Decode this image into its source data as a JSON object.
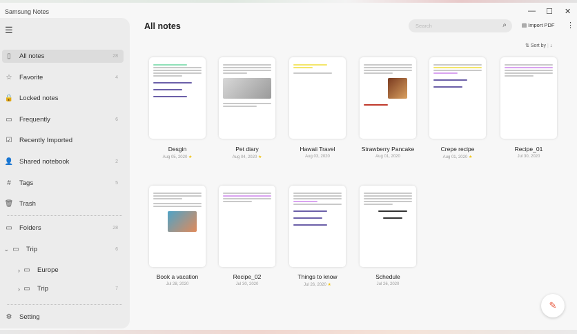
{
  "app_title": "Samsung Notes",
  "window": {
    "minimize": "—",
    "maximize": "☐",
    "close": "✕"
  },
  "sidebar": {
    "items": [
      {
        "label": "All notes",
        "count": "28",
        "icon": "▯"
      },
      {
        "label": "Favorite",
        "count": "4",
        "icon": "☆"
      },
      {
        "label": "Locked notes",
        "count": "",
        "icon": "🔒"
      },
      {
        "label": "Frequently",
        "count": "6",
        "icon": "▭"
      },
      {
        "label": "Recently Imported",
        "count": "",
        "icon": "☑"
      },
      {
        "label": "Shared notebook",
        "count": "2",
        "icon": "👤"
      },
      {
        "label": "Tags",
        "count": "5",
        "icon": "#"
      },
      {
        "label": "Trash",
        "count": "",
        "icon": "🗑"
      }
    ],
    "folders": {
      "label": "Folders",
      "count": "28"
    },
    "tree": [
      {
        "label": "Trip",
        "count": "6",
        "chev": "⌄"
      },
      {
        "label": "Europe",
        "count": "",
        "chev": "›"
      },
      {
        "label": "Trip",
        "count": "7",
        "chev": "›"
      }
    ],
    "setting": "Setting"
  },
  "main": {
    "title": "All notes",
    "search_placeholder": "Search",
    "import_label": "Import PDF",
    "sort_label": "Sort by",
    "notes": [
      {
        "title": "Desgin",
        "date": "Aug 05, 2020",
        "fav": true
      },
      {
        "title": "Pet diary",
        "date": "Aug 04, 2020",
        "fav": true
      },
      {
        "title": "Hawaii Travel",
        "date": "Aug 03, 2020",
        "fav": false
      },
      {
        "title": "Strawberry Pancake",
        "date": "Aug 01, 2020",
        "fav": false
      },
      {
        "title": "Crepe recipe",
        "date": "Aug 01, 2020",
        "fav": true
      },
      {
        "title": "Recipe_01",
        "date": "Jul 30, 2020",
        "fav": false
      },
      {
        "title": "Book a vacation",
        "date": "Jul 28, 2020",
        "fav": false
      },
      {
        "title": "Recipe_02",
        "date": "Jul 30, 2020",
        "fav": false
      },
      {
        "title": "Things to know",
        "date": "Jul 26, 2020",
        "fav": true
      },
      {
        "title": "Schedule",
        "date": "Jul 26, 2020",
        "fav": false
      }
    ]
  },
  "colors": {
    "accent": "#e8573c",
    "star": "#f1c40f"
  }
}
